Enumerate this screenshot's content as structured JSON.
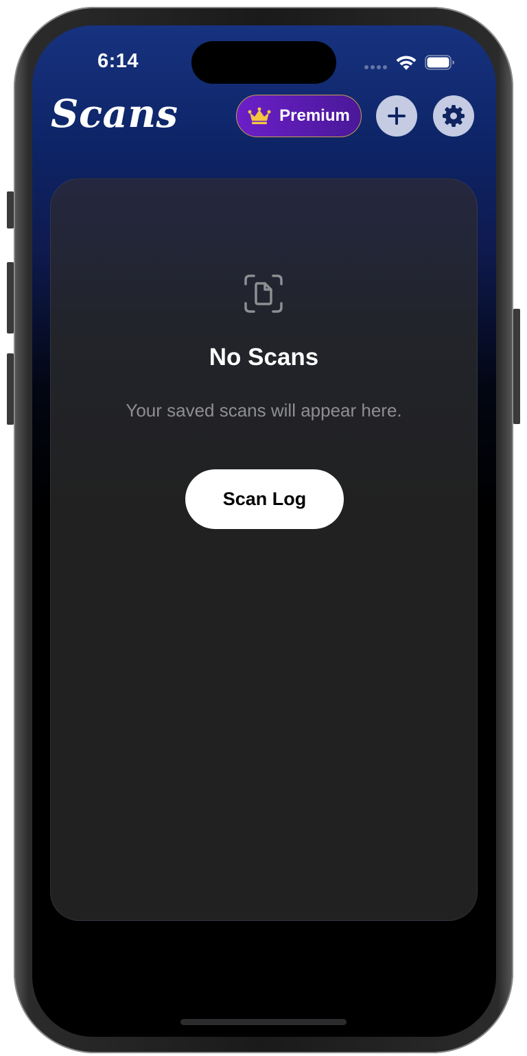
{
  "status_bar": {
    "time": "6:14"
  },
  "header": {
    "title": "Scans",
    "premium_label": "Premium",
    "add_icon": "plus-icon",
    "settings_icon": "gear-icon",
    "premium_icon": "crown-icon"
  },
  "empty_state": {
    "icon": "doc-viewfinder-icon",
    "title": "No Scans",
    "subtitle": "Your saved scans will appear here.",
    "button_label": "Scan Log"
  },
  "colors": {
    "header_gradient_top": "#17327f",
    "premium_purple": "#6b1fc8",
    "premium_border": "#c9a24a",
    "crown": "#f5c542",
    "circle_button_bg": "#c4cbe2",
    "circle_button_icon": "#0f2460",
    "card_bg": "#212121",
    "subtitle_gray": "#8e8e93"
  }
}
